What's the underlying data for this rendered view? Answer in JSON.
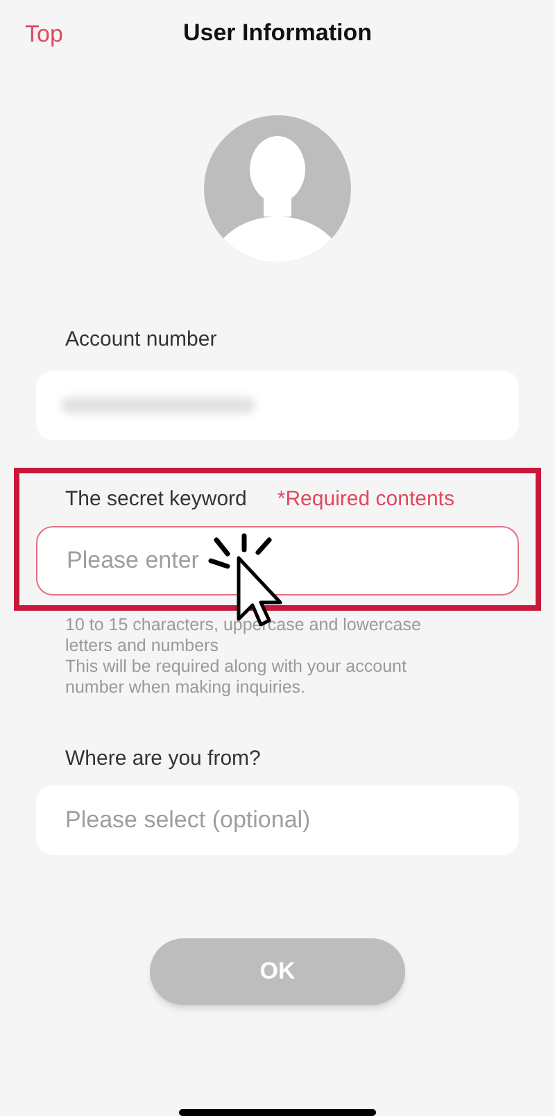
{
  "header": {
    "back_link": "Top",
    "title": "User Information"
  },
  "account": {
    "label": "Account number"
  },
  "keyword": {
    "label": "The secret keyword",
    "required_note": "*Required contents",
    "placeholder": "Please enter",
    "hints": [
      "10 to 15 characters, uppercase and lowercase letters and numbers",
      "This will be required along with your account number when making inquiries."
    ]
  },
  "origin": {
    "label": "Where are you from?",
    "placeholder": "Please select (optional)"
  },
  "ok_button": {
    "label": "OK",
    "disabled": true
  }
}
